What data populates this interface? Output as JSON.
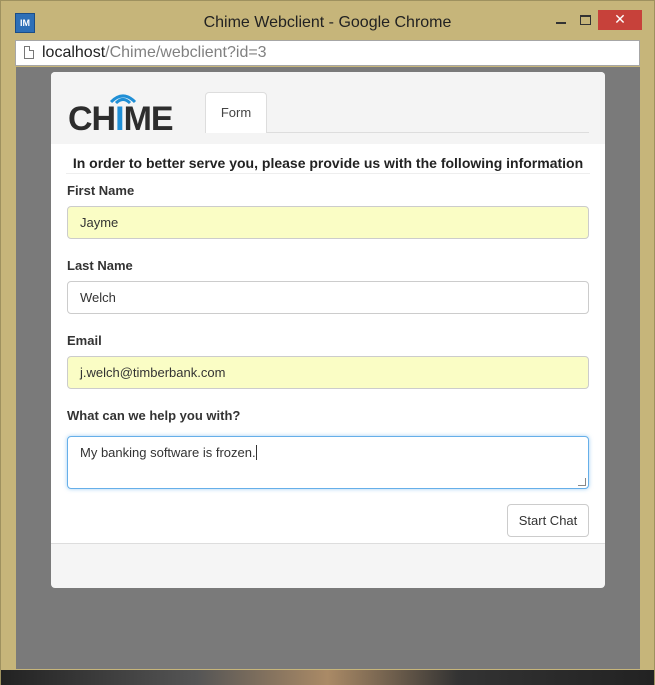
{
  "window": {
    "title": "Chime Webclient - Google Chrome",
    "app_icon_label": "IM",
    "close_glyph": "✕"
  },
  "address": {
    "host": "localhost",
    "path": "/Chime/webclient?id=3"
  },
  "header": {
    "logo_text_a": "CH",
    "logo_text_b": "I",
    "logo_text_c": "ME",
    "tab_label": "Form"
  },
  "form": {
    "intro": "In order to better serve you, please provide us with the following information",
    "first_name_label": "First Name",
    "first_name_value": "Jayme",
    "last_name_label": "Last Name",
    "last_name_value": "Welch",
    "email_label": "Email",
    "email_value": "j.welch@timberbank.com",
    "help_label": "What can we help you with?",
    "help_value": "My banking software is frozen.",
    "submit_label": "Start Chat"
  },
  "colors": {
    "titlebar": "#c6b57a",
    "close_button": "#c7413a",
    "autofill": "#fafdc5",
    "logo_blue": "#1f8fd6",
    "focus_border": "#66afe9"
  },
  "icons": [
    "chime-app-icon",
    "page-icon",
    "minimize-icon",
    "maximize-icon",
    "close-icon",
    "chime-logo"
  ]
}
